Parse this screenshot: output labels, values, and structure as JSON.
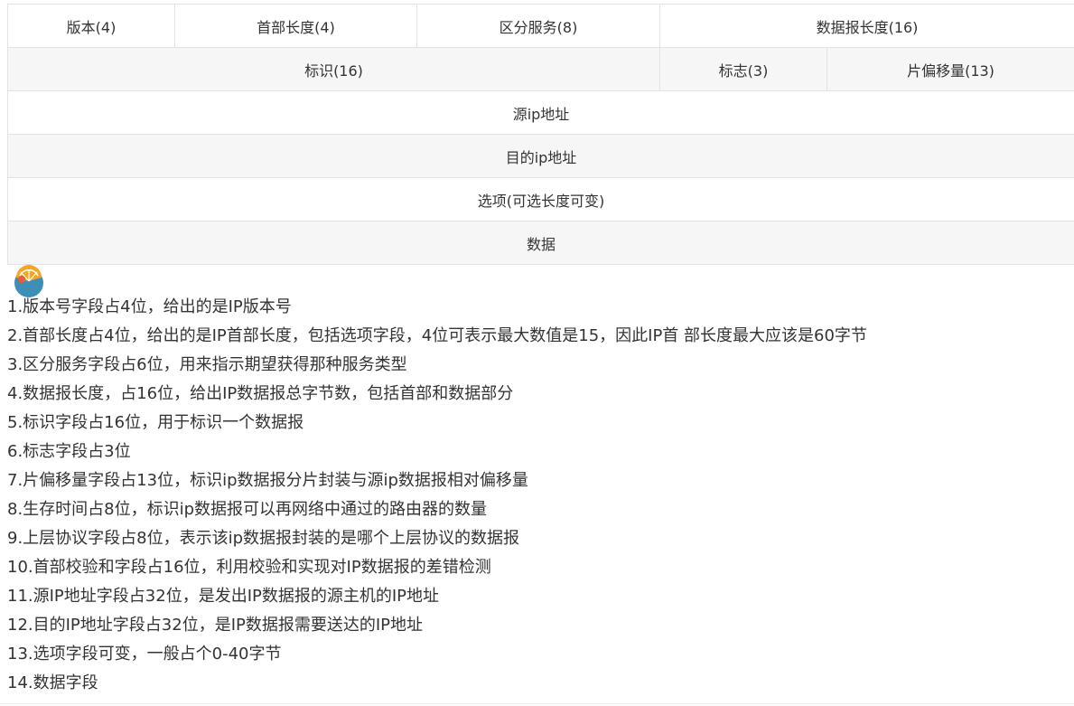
{
  "table": {
    "row1": {
      "version": "版本(4)",
      "header_length": "首部长度(4)",
      "diff_service": "区分服务(8)",
      "datagram_length": "数据报长度(16)"
    },
    "row2": {
      "identification": "标识(16)",
      "flags": "标志(3)",
      "fragment_offset": "片偏移量(13)"
    },
    "row3": {
      "source_ip": "源ip地址"
    },
    "row4": {
      "dest_ip": "目的ip地址"
    },
    "row5": {
      "options": "选项(可选长度可变)"
    },
    "row6": {
      "data": "数据"
    }
  },
  "badge": {
    "icon": "orange-slice-icon",
    "colors": {
      "circle": "#3d8fb5",
      "fruit": "#f5a623",
      "accent": "#e85d3a"
    }
  },
  "notes": [
    "1.版本号字段占4位，给出的是IP版本号",
    "2.首部长度占4位，给出的是IP首部长度，包括选项字段，4位可表示最大数值是15，因此IP首 部长度最大应该是60字节",
    "3.区分服务字段占6位，用来指示期望获得那种服务类型",
    "4.数据报长度，占16位，给出IP数据报总字节数，包括首部和数据部分",
    "5.标识字段占16位，用于标识一个数据报",
    "6.标志字段占3位",
    "7.片偏移量字段占13位，标识ip数据报分片封装与源ip数据报相对偏移量",
    "8.生存时间占8位，标识ip数据报可以再网络中通过的路由器的数量",
    "9.上层协议字段占8位，表示该ip数据报封装的是哪个上层协议的数据报",
    "10.首部校验和字段占16位，利用校验和实现对IP数据报的差错检测",
    "11.源IP地址字段占32位，是发出IP数据报的源主机的IP地址",
    "12.目的IP地址字段占32位，是IP数据报需要送达的IP地址",
    "13.选项字段可变，一般占个0-40字节",
    "14.数据字段"
  ]
}
